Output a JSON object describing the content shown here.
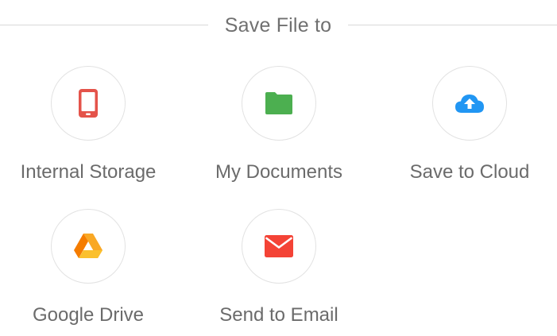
{
  "header": {
    "title": "Save File to"
  },
  "options": [
    {
      "label": "Internal Storage",
      "icon": "phone-icon",
      "color": "#e4534a"
    },
    {
      "label": "My Documents",
      "icon": "folder-icon",
      "color": "#4caf50"
    },
    {
      "label": "Save to Cloud",
      "icon": "cloud-upload-icon",
      "color": "#2196f3"
    },
    {
      "label": "Google Drive",
      "icon": "google-drive-icon",
      "color": "#f9a825"
    },
    {
      "label": "Send to Email",
      "icon": "email-icon",
      "color": "#f44336"
    }
  ],
  "colors": {
    "divider": "#d9d9d9",
    "text": "#6b6b6b",
    "circle_border": "#e2e2e2"
  }
}
